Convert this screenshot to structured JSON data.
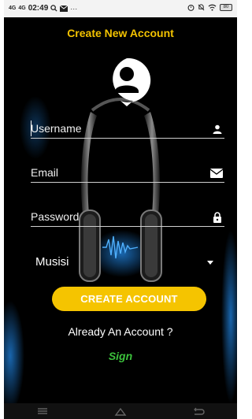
{
  "status_bar": {
    "signal1": "4G",
    "signal2": "4G",
    "time": "02:49",
    "extra": "···",
    "battery": "80"
  },
  "screen": {
    "title": "Create New Account"
  },
  "form": {
    "username_label": "Username",
    "email_label": "Email",
    "password_label": "Password",
    "role_value": "Musisi"
  },
  "actions": {
    "create_label": "CREATE ACCOUNT",
    "already_text": "Already An Account ?",
    "sign_label": "Sign"
  },
  "colors": {
    "accent": "#f5c400",
    "title": "#f2c200",
    "sign": "#3cc23c",
    "background": "#000000"
  },
  "icons": [
    "user-icon",
    "mail-icon",
    "lock-icon",
    "caret-down-icon",
    "menu-icon",
    "home-icon",
    "back-icon"
  ]
}
